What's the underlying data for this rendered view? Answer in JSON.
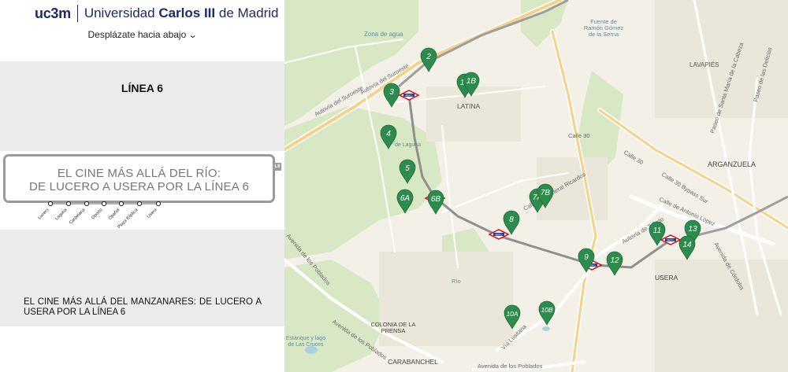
{
  "header": {
    "logo_short": "uc3m",
    "logo_name_1": "Universidad ",
    "logo_name_bold": "Carlos III",
    "logo_name_2": " de Madrid",
    "scroll_label": "Desplázate hacia abajo"
  },
  "line": {
    "title": "LÍNEA 6",
    "sign_line_1": "EL CINE MÁS ALLÁ DEL RÍO:",
    "sign_line_2": "DE LUCERO A USERA POR LA LÍNEA 6",
    "badge": "L6",
    "stops": [
      "Lucero",
      "Laguna",
      "Carpetana",
      "Oporto",
      "Opañel",
      "Plaza Elíptica",
      "Usera"
    ],
    "description": "EL CINE MÁS ALLÁ DEL MANZANARES: DE LUCERO A USERA POR LA LÍNEA 6"
  },
  "map": {
    "labels": {
      "zona_agua": "Zona de agua",
      "fuente_1": "Fuente de",
      "fuente_2": "Ramón Gómez",
      "fuente_3": "de la Serna",
      "lavapies": "LAVAPIÉS",
      "latina": "LATINA",
      "arganzuela": "ARGANZUELA",
      "usera": "USERA",
      "colonia_1": "COLONIA DE LA",
      "colonia_2": "PRENSA",
      "carabanchel": "CARABANCHEL",
      "estanque_1": "Estanque y lago",
      "estanque_2": "de Las Cruces",
      "rio": "Río",
      "laguna": "de Laguna",
      "autovia_suroeste_1": "Autovía del Suroeste",
      "autovia_suroeste_2": "Autovía del Suroeste",
      "calle30_1": "Calle 30",
      "calle30_2": "Calle 30",
      "bypass": "Calle 30 Bypass Sur",
      "toledo": "Autovía de Toledo",
      "via_lusitana": "Vía Lusitana",
      "av_poblados": "Avenida de los Poblados",
      "av_poblados_2": "Avenida de los Poblados",
      "av_poblados_3": "Avenida de los Poblados",
      "cordoba": "Avenida de Córdoba",
      "delicias": "Paseo de las Delicias",
      "sta_maria": "Paseo de Santa María de la Cabeza",
      "antonio_lopez": "Calle de Antonio López",
      "general_ricardos": "Calle del General Ricardos"
    },
    "markers": [
      "2",
      "1A",
      "1B",
      "3",
      "4",
      "5",
      "6A",
      "6B",
      "7A",
      "7B",
      "8",
      "9",
      "10A",
      "10B",
      "11",
      "12",
      "13",
      "14"
    ],
    "metro_label": "Metro",
    "colors": {
      "marker": "#2e8b4e",
      "route": "#8f8f8f",
      "metro": "#e30613"
    }
  }
}
